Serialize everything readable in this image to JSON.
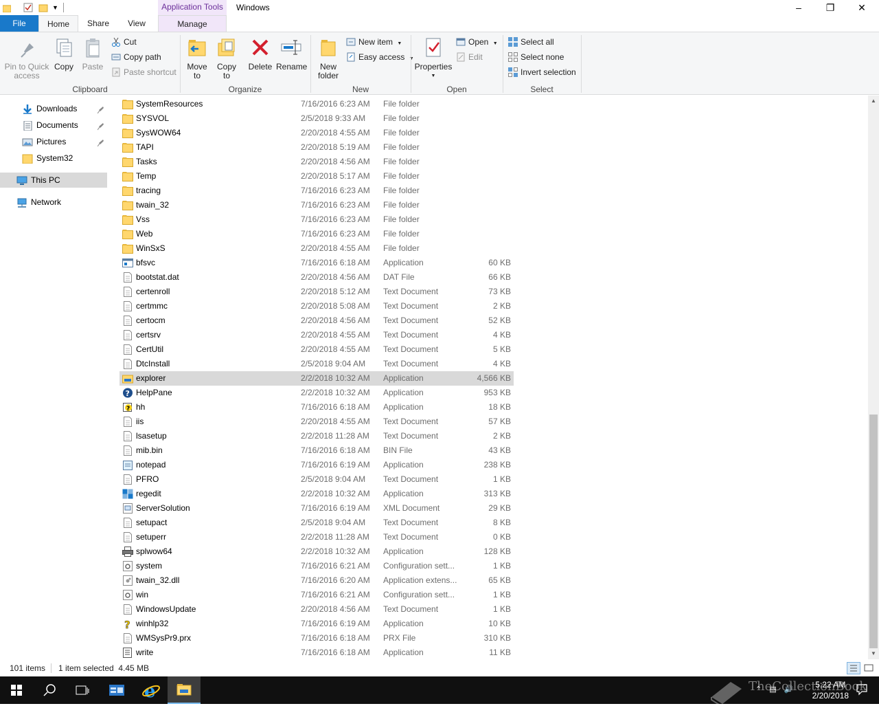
{
  "titlebar": {
    "contextual_tab": "Application Tools",
    "title": "Windows"
  },
  "tabs": {
    "file": "File",
    "home": "Home",
    "share": "Share",
    "view": "View",
    "manage": "Manage"
  },
  "ribbon": {
    "clipboard": {
      "pin": "Pin to Quick access",
      "copy": "Copy",
      "paste": "Paste",
      "cut": "Cut",
      "copy_path": "Copy path",
      "paste_shortcut": "Paste shortcut",
      "label": "Clipboard"
    },
    "organize": {
      "move_to": "Move to",
      "copy_to": "Copy to",
      "delete": "Delete",
      "rename": "Rename",
      "label": "Organize"
    },
    "new": {
      "new_folder": "New folder",
      "new_item": "New item",
      "easy_access": "Easy access",
      "label": "New"
    },
    "open": {
      "properties": "Properties",
      "open": "Open",
      "edit": "Edit",
      "label": "Open"
    },
    "select": {
      "select_all": "Select all",
      "select_none": "Select none",
      "invert": "Invert selection",
      "label": "Select"
    }
  },
  "nav": {
    "items": [
      {
        "label": "Downloads",
        "icon": "download-icon"
      },
      {
        "label": "Documents",
        "icon": "documents-icon"
      },
      {
        "label": "Pictures",
        "icon": "pictures-icon"
      },
      {
        "label": "System32",
        "icon": "folder-icon"
      },
      {
        "label": "This PC",
        "icon": "this-pc-icon"
      },
      {
        "label": "Network",
        "icon": "network-icon"
      }
    ]
  },
  "files": [
    {
      "name": "SystemResources",
      "date": "7/16/2016 6:23 AM",
      "type": "File folder",
      "size": "",
      "icon": "folder"
    },
    {
      "name": "SYSVOL",
      "date": "2/5/2018 9:33 AM",
      "type": "File folder",
      "size": "",
      "icon": "folder"
    },
    {
      "name": "SysWOW64",
      "date": "2/20/2018 4:55 AM",
      "type": "File folder",
      "size": "",
      "icon": "folder"
    },
    {
      "name": "TAPI",
      "date": "2/20/2018 5:19 AM",
      "type": "File folder",
      "size": "",
      "icon": "folder"
    },
    {
      "name": "Tasks",
      "date": "2/20/2018 4:56 AM",
      "type": "File folder",
      "size": "",
      "icon": "folder"
    },
    {
      "name": "Temp",
      "date": "2/20/2018 5:17 AM",
      "type": "File folder",
      "size": "",
      "icon": "folder"
    },
    {
      "name": "tracing",
      "date": "7/16/2016 6:23 AM",
      "type": "File folder",
      "size": "",
      "icon": "folder"
    },
    {
      "name": "twain_32",
      "date": "7/16/2016 6:23 AM",
      "type": "File folder",
      "size": "",
      "icon": "folder"
    },
    {
      "name": "Vss",
      "date": "7/16/2016 6:23 AM",
      "type": "File folder",
      "size": "",
      "icon": "folder"
    },
    {
      "name": "Web",
      "date": "7/16/2016 6:23 AM",
      "type": "File folder",
      "size": "",
      "icon": "folder"
    },
    {
      "name": "WinSxS",
      "date": "2/20/2018 4:55 AM",
      "type": "File folder",
      "size": "",
      "icon": "folder"
    },
    {
      "name": "bfsvc",
      "date": "7/16/2016 6:18 AM",
      "type": "Application",
      "size": "60 KB",
      "icon": "app"
    },
    {
      "name": "bootstat.dat",
      "date": "2/20/2018 4:56 AM",
      "type": "DAT File",
      "size": "66 KB",
      "icon": "doc"
    },
    {
      "name": "certenroll",
      "date": "2/20/2018 5:12 AM",
      "type": "Text Document",
      "size": "73 KB",
      "icon": "doc"
    },
    {
      "name": "certmmc",
      "date": "2/20/2018 5:08 AM",
      "type": "Text Document",
      "size": "2 KB",
      "icon": "doc"
    },
    {
      "name": "certocm",
      "date": "2/20/2018 4:56 AM",
      "type": "Text Document",
      "size": "52 KB",
      "icon": "doc"
    },
    {
      "name": "certsrv",
      "date": "2/20/2018 4:55 AM",
      "type": "Text Document",
      "size": "4 KB",
      "icon": "doc"
    },
    {
      "name": "CertUtil",
      "date": "2/20/2018 4:55 AM",
      "type": "Text Document",
      "size": "5 KB",
      "icon": "doc"
    },
    {
      "name": "DtcInstall",
      "date": "2/5/2018 9:04 AM",
      "type": "Text Document",
      "size": "4 KB",
      "icon": "doc"
    },
    {
      "name": "explorer",
      "date": "2/2/2018 10:32 AM",
      "type": "Application",
      "size": "4,566 KB",
      "icon": "explorer"
    },
    {
      "name": "HelpPane",
      "date": "2/2/2018 10:32 AM",
      "type": "Application",
      "size": "953 KB",
      "icon": "help"
    },
    {
      "name": "hh",
      "date": "7/16/2016 6:18 AM",
      "type": "Application",
      "size": "18 KB",
      "icon": "hh"
    },
    {
      "name": "iis",
      "date": "2/20/2018 4:55 AM",
      "type": "Text Document",
      "size": "57 KB",
      "icon": "doc"
    },
    {
      "name": "lsasetup",
      "date": "2/2/2018 11:28 AM",
      "type": "Text Document",
      "size": "2 KB",
      "icon": "doc"
    },
    {
      "name": "mib.bin",
      "date": "7/16/2016 6:18 AM",
      "type": "BIN File",
      "size": "43 KB",
      "icon": "doc"
    },
    {
      "name": "notepad",
      "date": "7/16/2016 6:19 AM",
      "type": "Application",
      "size": "238 KB",
      "icon": "notepad"
    },
    {
      "name": "PFRO",
      "date": "2/5/2018 9:04 AM",
      "type": "Text Document",
      "size": "1 KB",
      "icon": "doc"
    },
    {
      "name": "regedit",
      "date": "2/2/2018 10:32 AM",
      "type": "Application",
      "size": "313 KB",
      "icon": "regedit"
    },
    {
      "name": "ServerSolution",
      "date": "7/16/2016 6:19 AM",
      "type": "XML Document",
      "size": "29 KB",
      "icon": "xml"
    },
    {
      "name": "setupact",
      "date": "2/5/2018 9:04 AM",
      "type": "Text Document",
      "size": "8 KB",
      "icon": "doc"
    },
    {
      "name": "setuperr",
      "date": "2/2/2018 11:28 AM",
      "type": "Text Document",
      "size": "0 KB",
      "icon": "doc"
    },
    {
      "name": "splwow64",
      "date": "2/2/2018 10:32 AM",
      "type": "Application",
      "size": "128 KB",
      "icon": "printer"
    },
    {
      "name": "system",
      "date": "7/16/2016 6:21 AM",
      "type": "Configuration sett...",
      "size": "1 KB",
      "icon": "config"
    },
    {
      "name": "twain_32.dll",
      "date": "7/16/2016 6:20 AM",
      "type": "Application extens...",
      "size": "65 KB",
      "icon": "dll"
    },
    {
      "name": "win",
      "date": "7/16/2016 6:21 AM",
      "type": "Configuration sett...",
      "size": "1 KB",
      "icon": "config"
    },
    {
      "name": "WindowsUpdate",
      "date": "2/20/2018 4:56 AM",
      "type": "Text Document",
      "size": "1 KB",
      "icon": "doc"
    },
    {
      "name": "winhlp32",
      "date": "7/16/2016 6:19 AM",
      "type": "Application",
      "size": "10 KB",
      "icon": "winhlp"
    },
    {
      "name": "WMSysPr9.prx",
      "date": "7/16/2016 6:18 AM",
      "type": "PRX File",
      "size": "310 KB",
      "icon": "doc"
    },
    {
      "name": "write",
      "date": "7/16/2016 6:18 AM",
      "type": "Application",
      "size": "11 KB",
      "icon": "write"
    }
  ],
  "selected_file": "explorer",
  "status": {
    "count": "101 items",
    "selection": "1 item selected  4.45 MB"
  },
  "taskbar": {
    "time": "5:22 AM",
    "date": "2/20/2018",
    "watermark": "TheCollectionBook"
  },
  "colors": {
    "accent": "#1979ca",
    "contextual": "#f1e6f9",
    "selection": "#d9d9d9",
    "taskbar": "#101010"
  }
}
